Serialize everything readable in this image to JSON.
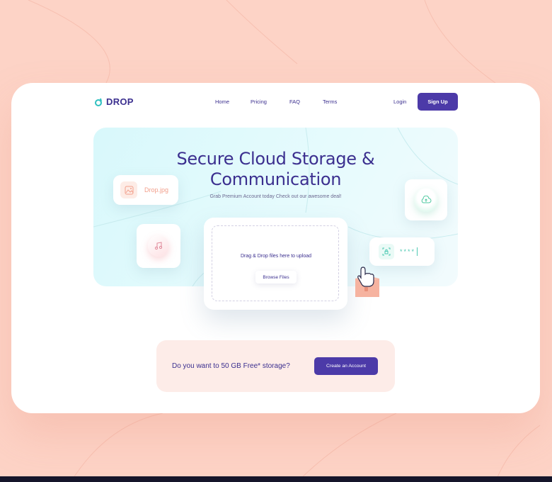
{
  "brand": {
    "name": "DROP",
    "accent": "#4c3aa8",
    "teal": "#2fc0c0",
    "peach": "#fdd3c6"
  },
  "nav": {
    "items": [
      "Home",
      "Pricing",
      "FAQ",
      "Terms"
    ],
    "login": "Login",
    "signup": "Sign Up"
  },
  "hero": {
    "title_line1": "Secure Cloud Storage &",
    "title_line2": "Communication",
    "subtitle": "Grab Premium Account today Check out our awesome deal!"
  },
  "floating": {
    "file_name": "Drop.jpg",
    "image_icon": "image-icon",
    "music_icon": "music-note-icon",
    "cloud_icon": "cloud-upload-icon",
    "lock_icon": "lock-icon",
    "password_mask": "****"
  },
  "upload": {
    "prompt": "Drag & Drop files here to upload",
    "browse": "Browse Files",
    "cursor_icon": "hand-pointer-icon"
  },
  "cta": {
    "text": "Do you want to 50 GB Free* storage?",
    "button": "Create an Account"
  }
}
